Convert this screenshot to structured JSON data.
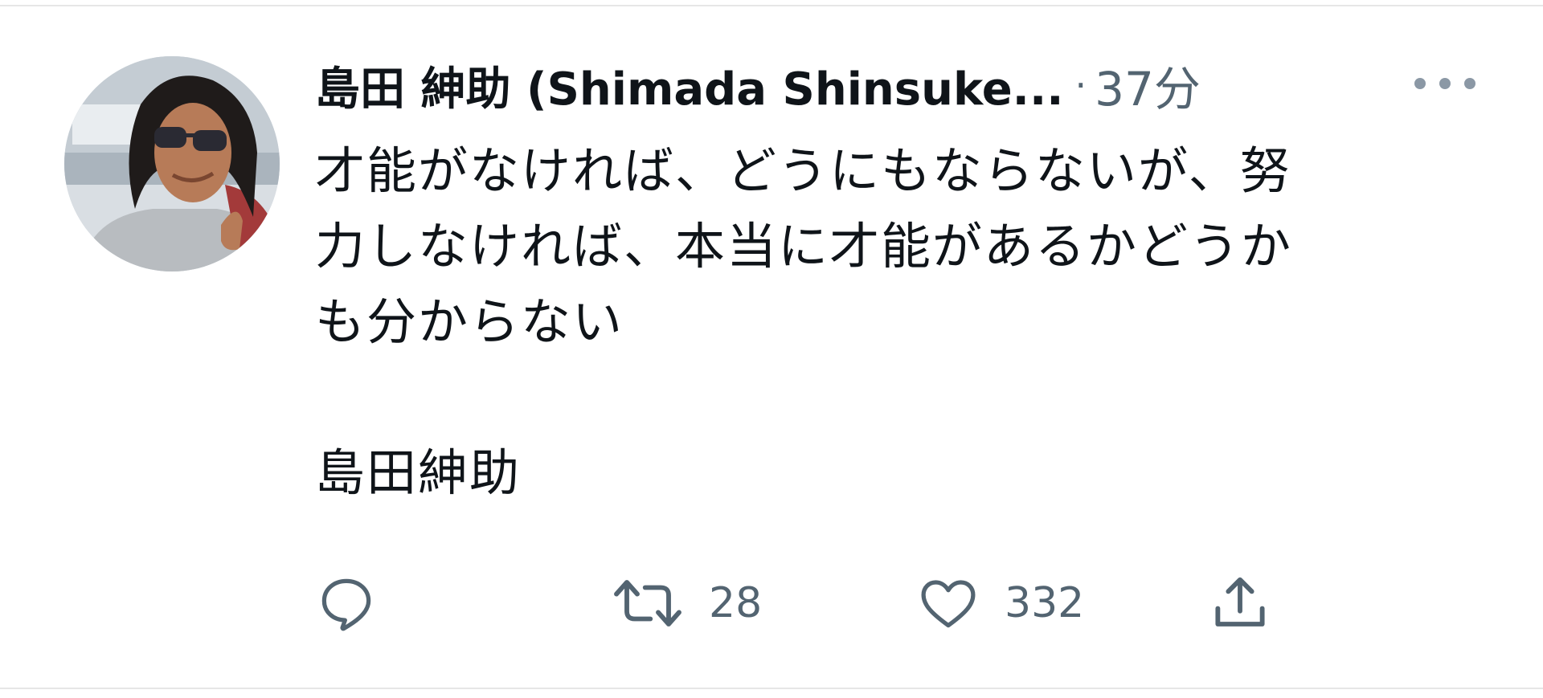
{
  "tweet": {
    "display_name": "島田 紳助 (Shimada Shinsuke...",
    "separator": "·",
    "time": "37分",
    "text_lines": [
      "才能がなければ、どうにもならないが、努",
      "力しなければ、本当に才能があるかどうか",
      "も分からない",
      "",
      "島田紳助"
    ]
  },
  "actions": {
    "reply": {
      "icon": "reply-icon",
      "count": ""
    },
    "retweet": {
      "icon": "retweet-icon",
      "count": "28"
    },
    "like": {
      "icon": "heart-icon",
      "count": "332"
    },
    "share": {
      "icon": "share-icon",
      "count": ""
    }
  },
  "colors": {
    "text": "#0f1419",
    "secondary": "#536471",
    "divider": "#e6e6e6",
    "background": "#ffffff"
  }
}
